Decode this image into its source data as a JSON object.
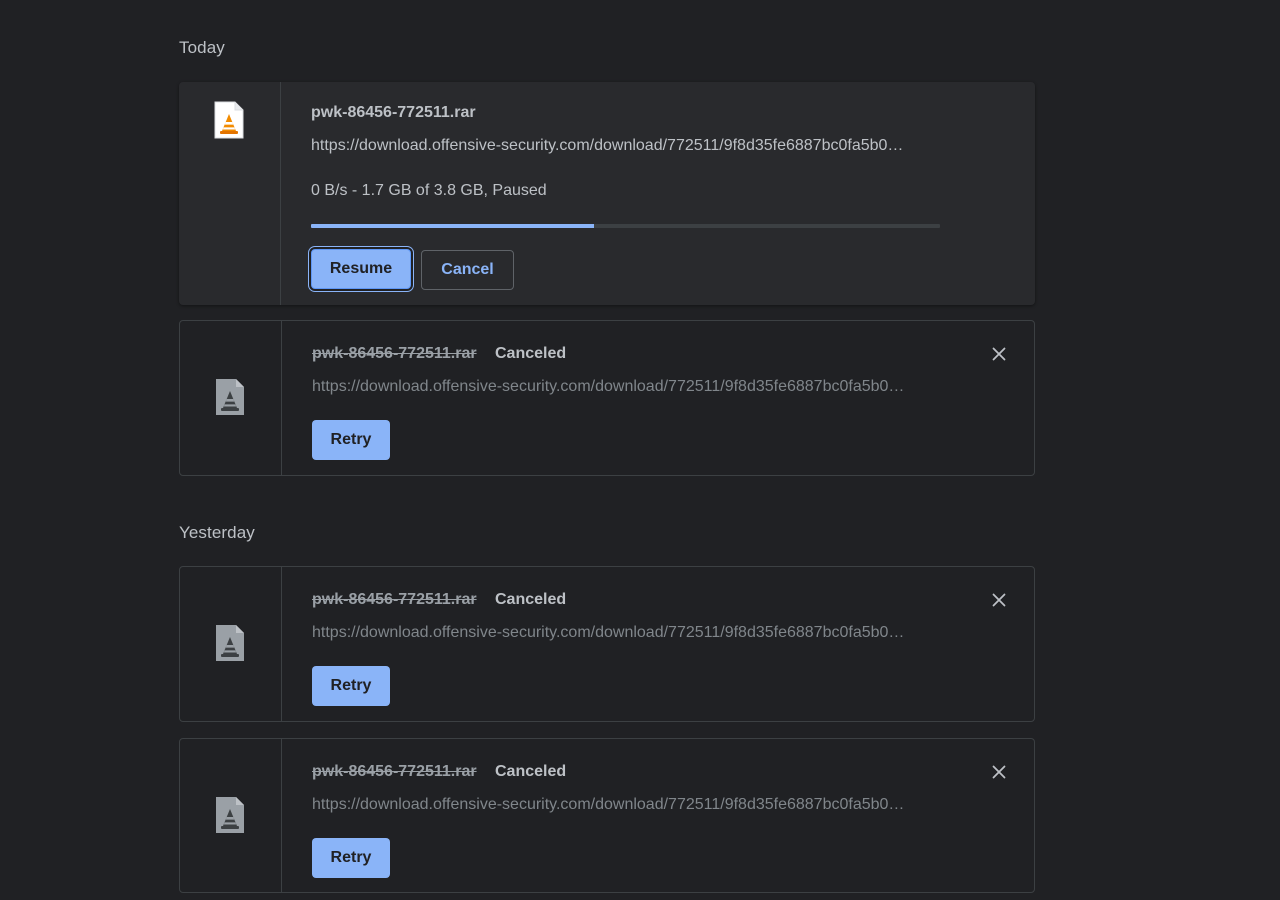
{
  "groups": [
    {
      "date": "Today",
      "items": [
        {
          "file_name": "pwk-86456-772511.rar",
          "url": "https://download.offensive-security.com/download/772511/9f8d35fe6887bc0fa5b0…",
          "status_text": "0 B/s - 1.7 GB of 3.8 GB, Paused",
          "progress_fraction": 0.45,
          "resume_label": "Resume",
          "cancel_label": "Cancel",
          "icon": "vlc-file-icon"
        },
        {
          "file_name": "pwk-86456-772511.rar",
          "state": "Canceled",
          "url": "https://download.offensive-security.com/download/772511/9f8d35fe6887bc0fa5b0…",
          "retry_label": "Retry",
          "icon": "vlc-file-icon-grey"
        }
      ]
    },
    {
      "date": "Yesterday",
      "items": [
        {
          "file_name": "pwk-86456-772511.rar",
          "state": "Canceled",
          "url": "https://download.offensive-security.com/download/772511/9f8d35fe6887bc0fa5b0…",
          "retry_label": "Retry",
          "icon": "vlc-file-icon-grey"
        },
        {
          "file_name": "pwk-86456-772511.rar",
          "state": "Canceled",
          "url": "https://download.offensive-security.com/download/772511/9f8d35fe6887bc0fa5b0…",
          "retry_label": "Retry",
          "icon": "vlc-file-icon-grey"
        }
      ]
    }
  ],
  "colors": {
    "background": "#202124",
    "accent": "#8ab4f8",
    "card_active": "#292a2d",
    "border": "#3c4043"
  }
}
